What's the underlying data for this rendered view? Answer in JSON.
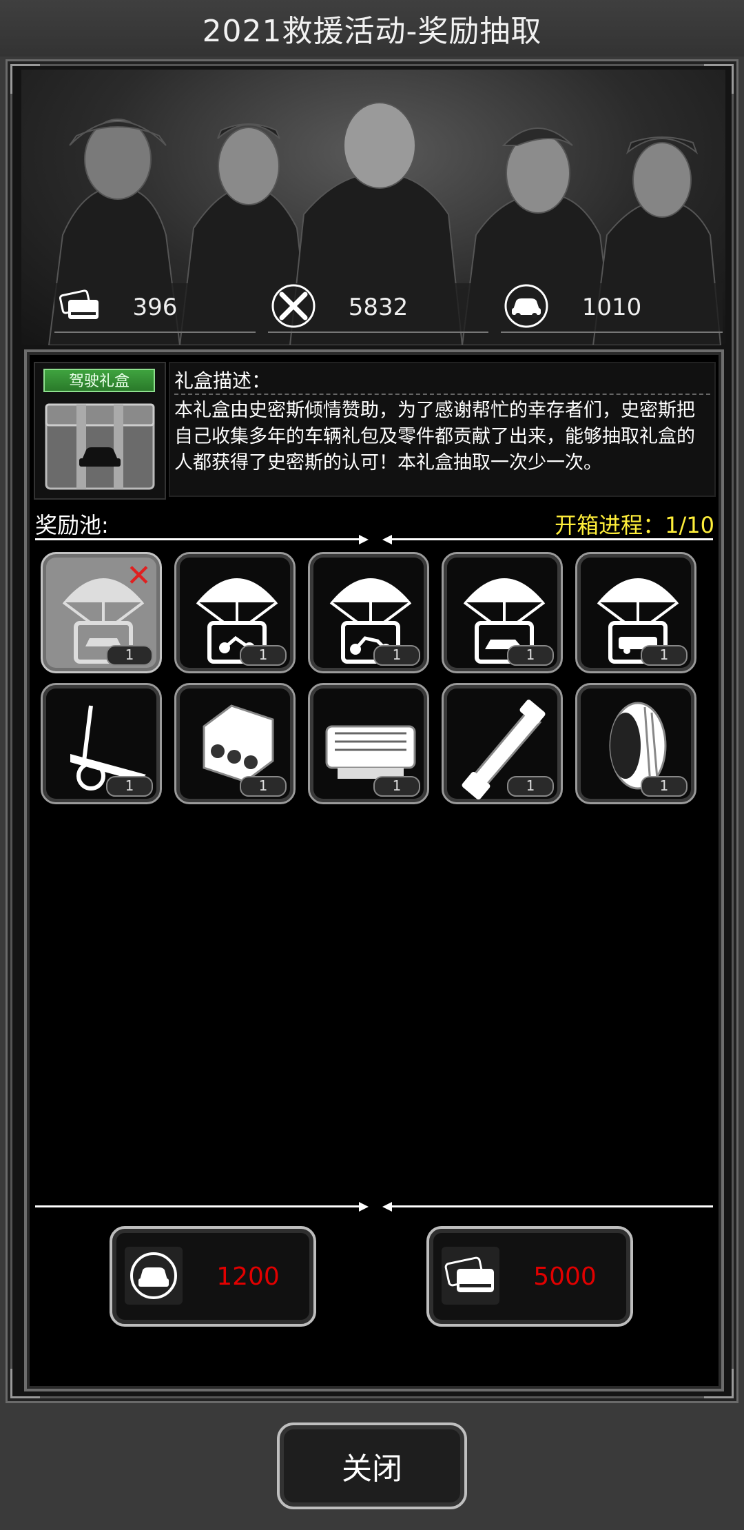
{
  "window": {
    "title": "2021救援活动-奖励抽取"
  },
  "stats": [
    {
      "icon": "ticket-card-icon",
      "value": "396"
    },
    {
      "icon": "crossed-swords-icon",
      "value": "5832"
    },
    {
      "icon": "car-token-icon",
      "value": "1010"
    }
  ],
  "gift": {
    "tag": "驾驶礼盒",
    "desc_title": "礼盒描述：",
    "desc_body": "本礼盒由史密斯倾情赞助，为了感谢帮忙的幸存者们，史密斯把自己收集多年的车辆礼包及零件都贡献了出来，能够抽取礼盒的人都获得了史密斯的认可！本礼盒抽取一次少一次。"
  },
  "pool": {
    "label": "奖励池:",
    "progress": "开箱进程：1/10",
    "items": [
      {
        "icon": "parachute-car-icon",
        "count": "1",
        "claimed": true
      },
      {
        "icon": "parachute-motorbike-icon",
        "count": "1",
        "claimed": false
      },
      {
        "icon": "parachute-chopper-icon",
        "count": "1",
        "claimed": false
      },
      {
        "icon": "parachute-sedan-icon",
        "count": "1",
        "claimed": false
      },
      {
        "icon": "parachute-suv-icon",
        "count": "1",
        "claimed": false
      },
      {
        "icon": "trailer-icon",
        "count": "1",
        "claimed": false
      },
      {
        "icon": "v-engine-icon",
        "count": "1",
        "claimed": false
      },
      {
        "icon": "inline-engine-icon",
        "count": "1",
        "claimed": false
      },
      {
        "icon": "driveshaft-icon",
        "count": "1",
        "claimed": false
      },
      {
        "icon": "tire-icon",
        "count": "1",
        "claimed": false
      }
    ]
  },
  "buy": [
    {
      "icon": "car-token-icon",
      "price": "1200"
    },
    {
      "icon": "ticket-card-icon",
      "price": "5000"
    }
  ],
  "close_label": "关闭",
  "colors": {
    "accent_yellow": "#ffef3a",
    "price_red": "#e10000",
    "tag_green": "#3fa33f"
  }
}
